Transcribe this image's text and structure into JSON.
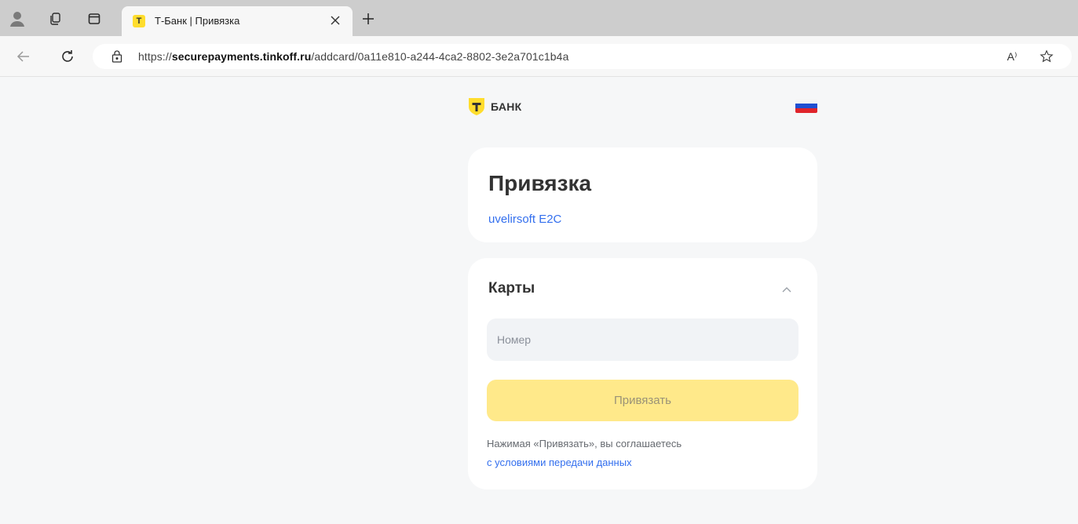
{
  "browser": {
    "tab_title": "Т-Банк | Привязка",
    "favicon_letter": "Т",
    "url_scheme": "https://",
    "url_host": "securepayments.tinkoff.ru",
    "url_path": "/addcard/0a11e810-a244-4ca2-8802-3e2a701c1b4a",
    "read_aloud_label": "A⁾"
  },
  "header": {
    "logo_text": "БАНК",
    "logo_letter": "Т",
    "brand_color": "#ffdd2d"
  },
  "title_card": {
    "title": "Привязка",
    "merchant": "uvelirsoft E2C"
  },
  "cards_section": {
    "title": "Карты",
    "number_placeholder": "Номер",
    "submit_label": "Привязать",
    "terms_text": "Нажимая «Привязать», вы соглашаетесь",
    "terms_link": "с условиями передачи данных"
  }
}
